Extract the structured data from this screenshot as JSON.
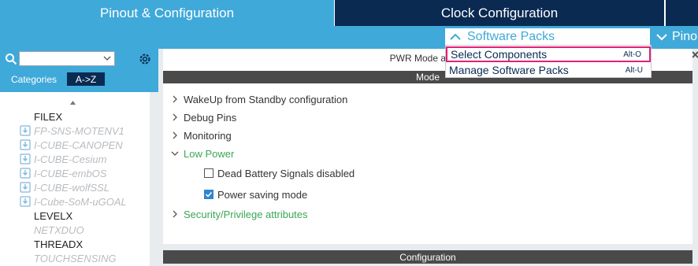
{
  "tabs": {
    "pinout": "Pinout & Configuration",
    "clock": "Clock Configuration"
  },
  "subbar": {
    "software_packs": "Software Packs",
    "pinout_label": "Pino"
  },
  "menu": {
    "items": [
      {
        "label": "Select Components",
        "shortcut": "Alt-O",
        "highlighted": true
      },
      {
        "label": "Manage Software Packs",
        "shortcut": "Alt-U",
        "highlighted": false
      }
    ]
  },
  "left_panel": {
    "search_value": "",
    "tab_categories": "Categories",
    "tab_az": "A->Z",
    "items": [
      {
        "label": "FILEX",
        "download_icon": false,
        "disabled": false
      },
      {
        "label": "FP-SNS-MOTENV1",
        "download_icon": true,
        "disabled": true
      },
      {
        "label": "I-CUBE-CANOPEN",
        "download_icon": true,
        "disabled": true
      },
      {
        "label": "I-CUBE-Cesium",
        "download_icon": true,
        "disabled": true
      },
      {
        "label": "I-CUBE-embOS",
        "download_icon": true,
        "disabled": true
      },
      {
        "label": "I-CUBE-wolfSSL",
        "download_icon": true,
        "disabled": true
      },
      {
        "label": "I-Cube-SoM-uGOAL",
        "download_icon": true,
        "disabled": true
      },
      {
        "label": "LEVELX",
        "download_icon": false,
        "disabled": false
      },
      {
        "label": "NETXDUO",
        "download_icon": false,
        "disabled": true
      },
      {
        "label": "THREADX",
        "download_icon": false,
        "disabled": false
      },
      {
        "label": "TOUCHSENSING",
        "download_icon": false,
        "disabled": true
      }
    ]
  },
  "right_panel": {
    "title": "PWR Mode and C",
    "mode_header": "Mode",
    "tree": [
      {
        "label": "WakeUp from Standby configuration",
        "expanded": false,
        "green": false
      },
      {
        "label": "Debug Pins",
        "expanded": false,
        "green": false
      },
      {
        "label": "Monitoring",
        "expanded": false,
        "green": false
      },
      {
        "label": "Low Power",
        "expanded": true,
        "green": true
      },
      {
        "label": "Security/Privilege attributes",
        "expanded": false,
        "green": true
      }
    ],
    "checkboxes": [
      {
        "label": "Dead Battery Signals disabled",
        "checked": false
      },
      {
        "label": "Power saving mode",
        "checked": true
      }
    ],
    "config_header": "Configuration"
  },
  "colors": {
    "accent": "#3fa9d9",
    "dark": "#0a2a52",
    "highlight": "#e0207a",
    "green": "#3aa655"
  }
}
